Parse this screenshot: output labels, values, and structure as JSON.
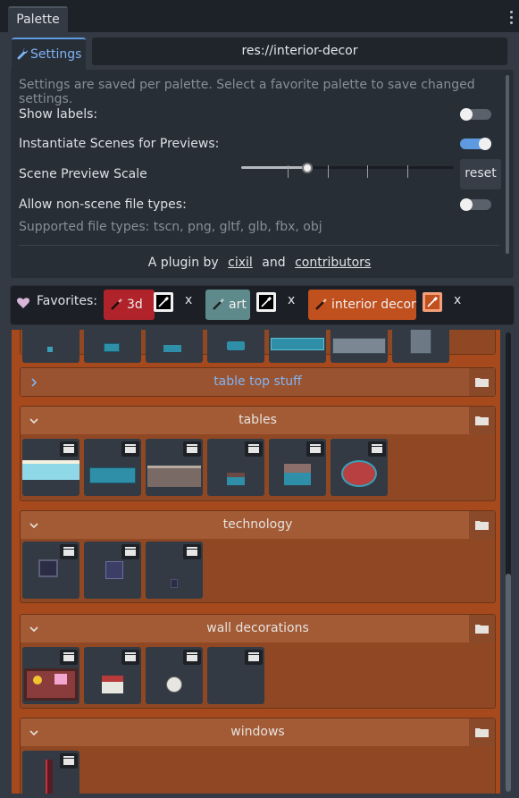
{
  "dock": {
    "tab_label": "Palette",
    "menu_icon": "kebab-menu-icon"
  },
  "settings_tab": {
    "label": "Settings",
    "icon": "wrench-icon"
  },
  "palette_path": "res://interior-decor",
  "settings": {
    "hint": "Settings are saved per palette. Select a favorite palette to save changed settings.",
    "show_labels": {
      "label": "Show labels:",
      "value": false
    },
    "instantiate": {
      "label": "Instantiate Scenes for Previews:",
      "value": true
    },
    "preview_scale": {
      "label": "Scene Preview Scale",
      "value": 0.3,
      "reset_label": "reset"
    },
    "non_scene": {
      "label": "Allow non-scene file types:",
      "value": false
    },
    "supported": "Supported file types: tscn, png, gltf, glb, fbx, obj"
  },
  "credit": {
    "prefix": "A plugin by",
    "author": "cixil",
    "and": "and",
    "contributors": "contributors"
  },
  "favorites": {
    "label": "Favorites:",
    "items": [
      {
        "name": "3d",
        "color": "#b0232a",
        "remove": "x"
      },
      {
        "name": "art",
        "color": "#5f8a8b",
        "remove": "x"
      },
      {
        "name": "interior decor",
        "color": "#c1501f",
        "remove": "x"
      }
    ]
  },
  "sections": [
    {
      "title": "table top stuff",
      "collapsed": true
    },
    {
      "title": "tables",
      "collapsed": false
    },
    {
      "title": "technology",
      "collapsed": false
    },
    {
      "title": "wall decorations",
      "collapsed": false
    },
    {
      "title": "windows",
      "collapsed": false
    }
  ],
  "colors": {
    "accent": "#5d9ae0",
    "grid_bg": "#a64a1e",
    "section_bg": "#8f4823",
    "tile_bg": "#333a43"
  }
}
